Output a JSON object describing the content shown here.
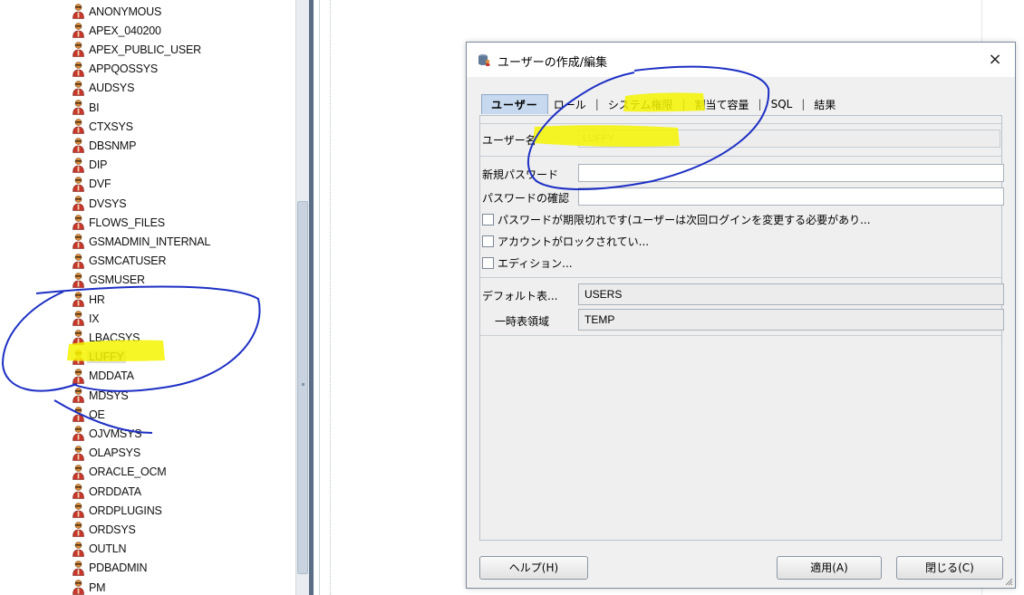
{
  "tree": {
    "users": [
      "ANONYMOUS",
      "APEX_040200",
      "APEX_PUBLIC_USER",
      "APPQOSSYS",
      "AUDSYS",
      "BI",
      "CTXSYS",
      "DBSNMP",
      "DIP",
      "DVF",
      "DVSYS",
      "FLOWS_FILES",
      "GSMADMIN_INTERNAL",
      "GSMCATUSER",
      "GSMUSER",
      "HR",
      "IX",
      "LBACSYS",
      "LUFFY",
      "MDDATA",
      "MDSYS",
      "OE",
      "OJVMSYS",
      "OLAPSYS",
      "ORACLE_OCM",
      "ORDDATA",
      "ORDPLUGINS",
      "ORDSYS",
      "OUTLN",
      "PDBADMIN",
      "PM"
    ],
    "selected": "LUFFY"
  },
  "dialog": {
    "title": "ユーザーの作成/編集",
    "close_label": "×",
    "tabs": [
      {
        "label": "ユーザー",
        "active": true
      },
      {
        "label": "ロール"
      },
      {
        "label": "システム権限"
      },
      {
        "label": "割当て容量"
      },
      {
        "label": "SQL"
      },
      {
        "label": "結果"
      }
    ],
    "username_label": "ユーザー名",
    "username_value": "LUFFY",
    "new_password_label": "新規パスワード",
    "new_password_value": "",
    "confirm_password_label": "パスワードの確認",
    "confirm_password_value": "",
    "checkboxes": [
      {
        "label": "パスワードが期限切れです(ユーザーは次回ログインを変更する必要があり...",
        "checked": false
      },
      {
        "label": "アカウントがロックされてい...",
        "checked": false
      },
      {
        "label": "エディション...",
        "checked": false
      }
    ],
    "default_tablespace_label": "デフォルト表...",
    "default_tablespace_value": "USERS",
    "temp_tablespace_label": "一時表領域",
    "temp_tablespace_value": "TEMP",
    "help_button": "ヘルプ(H)",
    "apply_button": "適用(A)",
    "close_button": "閉じる(C)"
  },
  "colors": {
    "highlight": "#f4f400",
    "annotation_pen": "#1d2fc4",
    "active_tab": "#c6d9ee",
    "user_icon_head": "#d98c3a",
    "user_icon_body": "#c8372b"
  }
}
